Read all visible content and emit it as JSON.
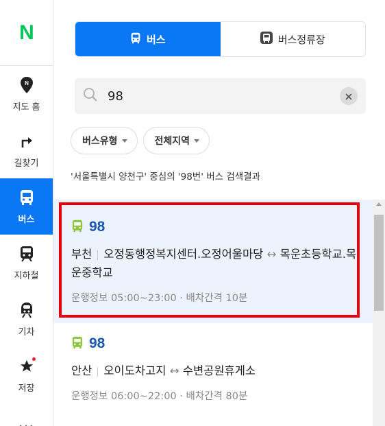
{
  "nav": {
    "logo": "N",
    "items": [
      {
        "label": "지도 홈",
        "icon": "map-pin-icon"
      },
      {
        "label": "길찾기",
        "icon": "directions-arrow-icon"
      },
      {
        "label": "버스",
        "icon": "bus-icon",
        "active": true
      },
      {
        "label": "지하철",
        "icon": "subway-icon"
      },
      {
        "label": "기차",
        "icon": "train-icon"
      },
      {
        "label": "저장",
        "icon": "star-icon"
      }
    ],
    "more": "..."
  },
  "tabs": [
    {
      "label": "버스",
      "icon": "bus-icon",
      "active": true
    },
    {
      "label": "버스정류장",
      "icon": "bus-stop-icon",
      "active": false
    }
  ],
  "search": {
    "value": "98",
    "placeholder": ""
  },
  "filters": [
    {
      "label": "버스유형"
    },
    {
      "label": "전체지역"
    }
  ],
  "result_description": "'서울특별시 양천구' 중심의 '98번' 버스 검색결과",
  "results": [
    {
      "number": "98",
      "region": "부천",
      "route_from": "오정동행정복지센터.오정어울마당",
      "arrow": "↔",
      "route_to": "목운초등학교.목운중학교",
      "meta": "운행정보 05:00~23:00 · 배차간격 10분"
    },
    {
      "number": "98",
      "region": "안산",
      "route_from": "오이도차고지",
      "arrow": "↔",
      "route_to": "수변공원휴게소",
      "meta": "운행정보 06:00~22:00 · 배차간격 80분"
    }
  ],
  "colors": {
    "accent": "#0a78f5",
    "logo": "#03c75a",
    "bus_green": "#8cc63e",
    "bus_number": "#1a56b4",
    "highlight": "#e8000b",
    "selected_bg": "#ecf3fd"
  }
}
